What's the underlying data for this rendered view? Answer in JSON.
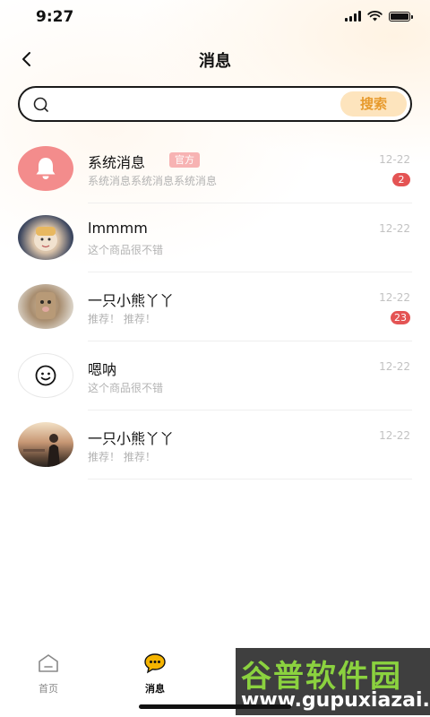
{
  "status_bar": {
    "time": "9:27"
  },
  "header": {
    "title": "消息",
    "back_icon": "chevron-left-icon"
  },
  "search": {
    "placeholder": "",
    "value": "",
    "button_label": "搜索"
  },
  "messages": [
    {
      "name": "系统消息",
      "badge": "官方",
      "date": "12-22",
      "preview": "系统消息系统消息系统消息",
      "unread": "2",
      "avatar": "bell-icon"
    },
    {
      "name": "lmmmm",
      "date": "12-22",
      "preview": "这个商品很不错",
      "avatar": "user-photo"
    },
    {
      "name": "一只小熊丫丫",
      "date": "12-22",
      "preview": "推荐！ 推荐！",
      "unread": "23",
      "avatar": "user-photo"
    },
    {
      "name": "嗯呐",
      "date": "12-22",
      "preview": "这个商品很不错",
      "avatar": "smiley-icon"
    },
    {
      "name": "一只小熊丫丫",
      "date": "12-22",
      "preview": "推荐！ 推荐！",
      "avatar": "user-photo"
    }
  ],
  "tab_bar": {
    "home_label": "首页",
    "messages_label": "消息"
  },
  "watermark": {
    "title": "谷普软件园",
    "url": "www.gupuxiazai.com"
  },
  "colors": {
    "accent_orange": "#e79a2c",
    "search_button_bg": "#fde4bd",
    "badge_red": "#e45454",
    "official_badge": "#f7b3b3",
    "bell_avatar": "#f38c8c",
    "tab_active_icon": "#f5b400"
  }
}
